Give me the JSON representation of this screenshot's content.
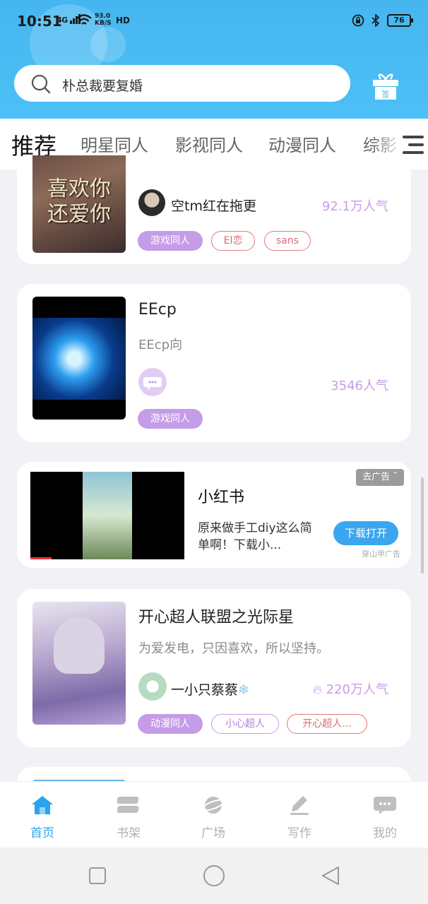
{
  "status_bar": {
    "time": "10:51",
    "signal": "4G",
    "speed_value": "93.0",
    "speed_unit": "KB/S",
    "hd": "HD",
    "battery": "76"
  },
  "header": {
    "search_placeholder": "朴总裁要复婚",
    "gift_label": "签"
  },
  "tabs": [
    {
      "label": "推荐",
      "active": true
    },
    {
      "label": "明星同人",
      "active": false
    },
    {
      "label": "影视同人",
      "active": false
    },
    {
      "label": "动漫同人",
      "active": false
    },
    {
      "label": "综影",
      "active": false
    }
  ],
  "cards": [
    {
      "cover_text": [
        "喜欢你",
        "还爱你"
      ],
      "author": "空tm红在拖更",
      "popularity": "92.1万人气",
      "tags": [
        "游戏同人",
        "El恋",
        "sans"
      ]
    },
    {
      "title": "EEcp",
      "description": "EEcp向",
      "popularity": "3546人气",
      "tags": [
        "游戏同人"
      ]
    },
    {
      "title": "开心超人联盟之光际星",
      "description": "为爱发电，只因喜欢，所以坚持。",
      "author": "一小只蔡蔡",
      "author_badge": "❄",
      "popularity": "220万人气",
      "tags": [
        "动漫同人",
        "小心超人",
        "开心超人..."
      ]
    }
  ],
  "ad": {
    "title": "小红书",
    "description": "原来做手工diy这么简单啊！下载小...",
    "button": "下载打开",
    "close": "去广告",
    "source": "穿山甲广告"
  },
  "bottom_nav": [
    {
      "label": "首页",
      "icon": "home-icon",
      "active": true
    },
    {
      "label": "书架",
      "icon": "bookshelf-icon",
      "active": false
    },
    {
      "label": "广场",
      "icon": "planet-icon",
      "active": false
    },
    {
      "label": "写作",
      "icon": "pen-icon",
      "active": false
    },
    {
      "label": "我的",
      "icon": "chat-bubble-icon",
      "active": false
    }
  ],
  "colors": {
    "header": "#46b6f0",
    "accent": "#2aa4ee",
    "tag_fill": "#c59ce8",
    "popularity": "#c79ce6"
  }
}
